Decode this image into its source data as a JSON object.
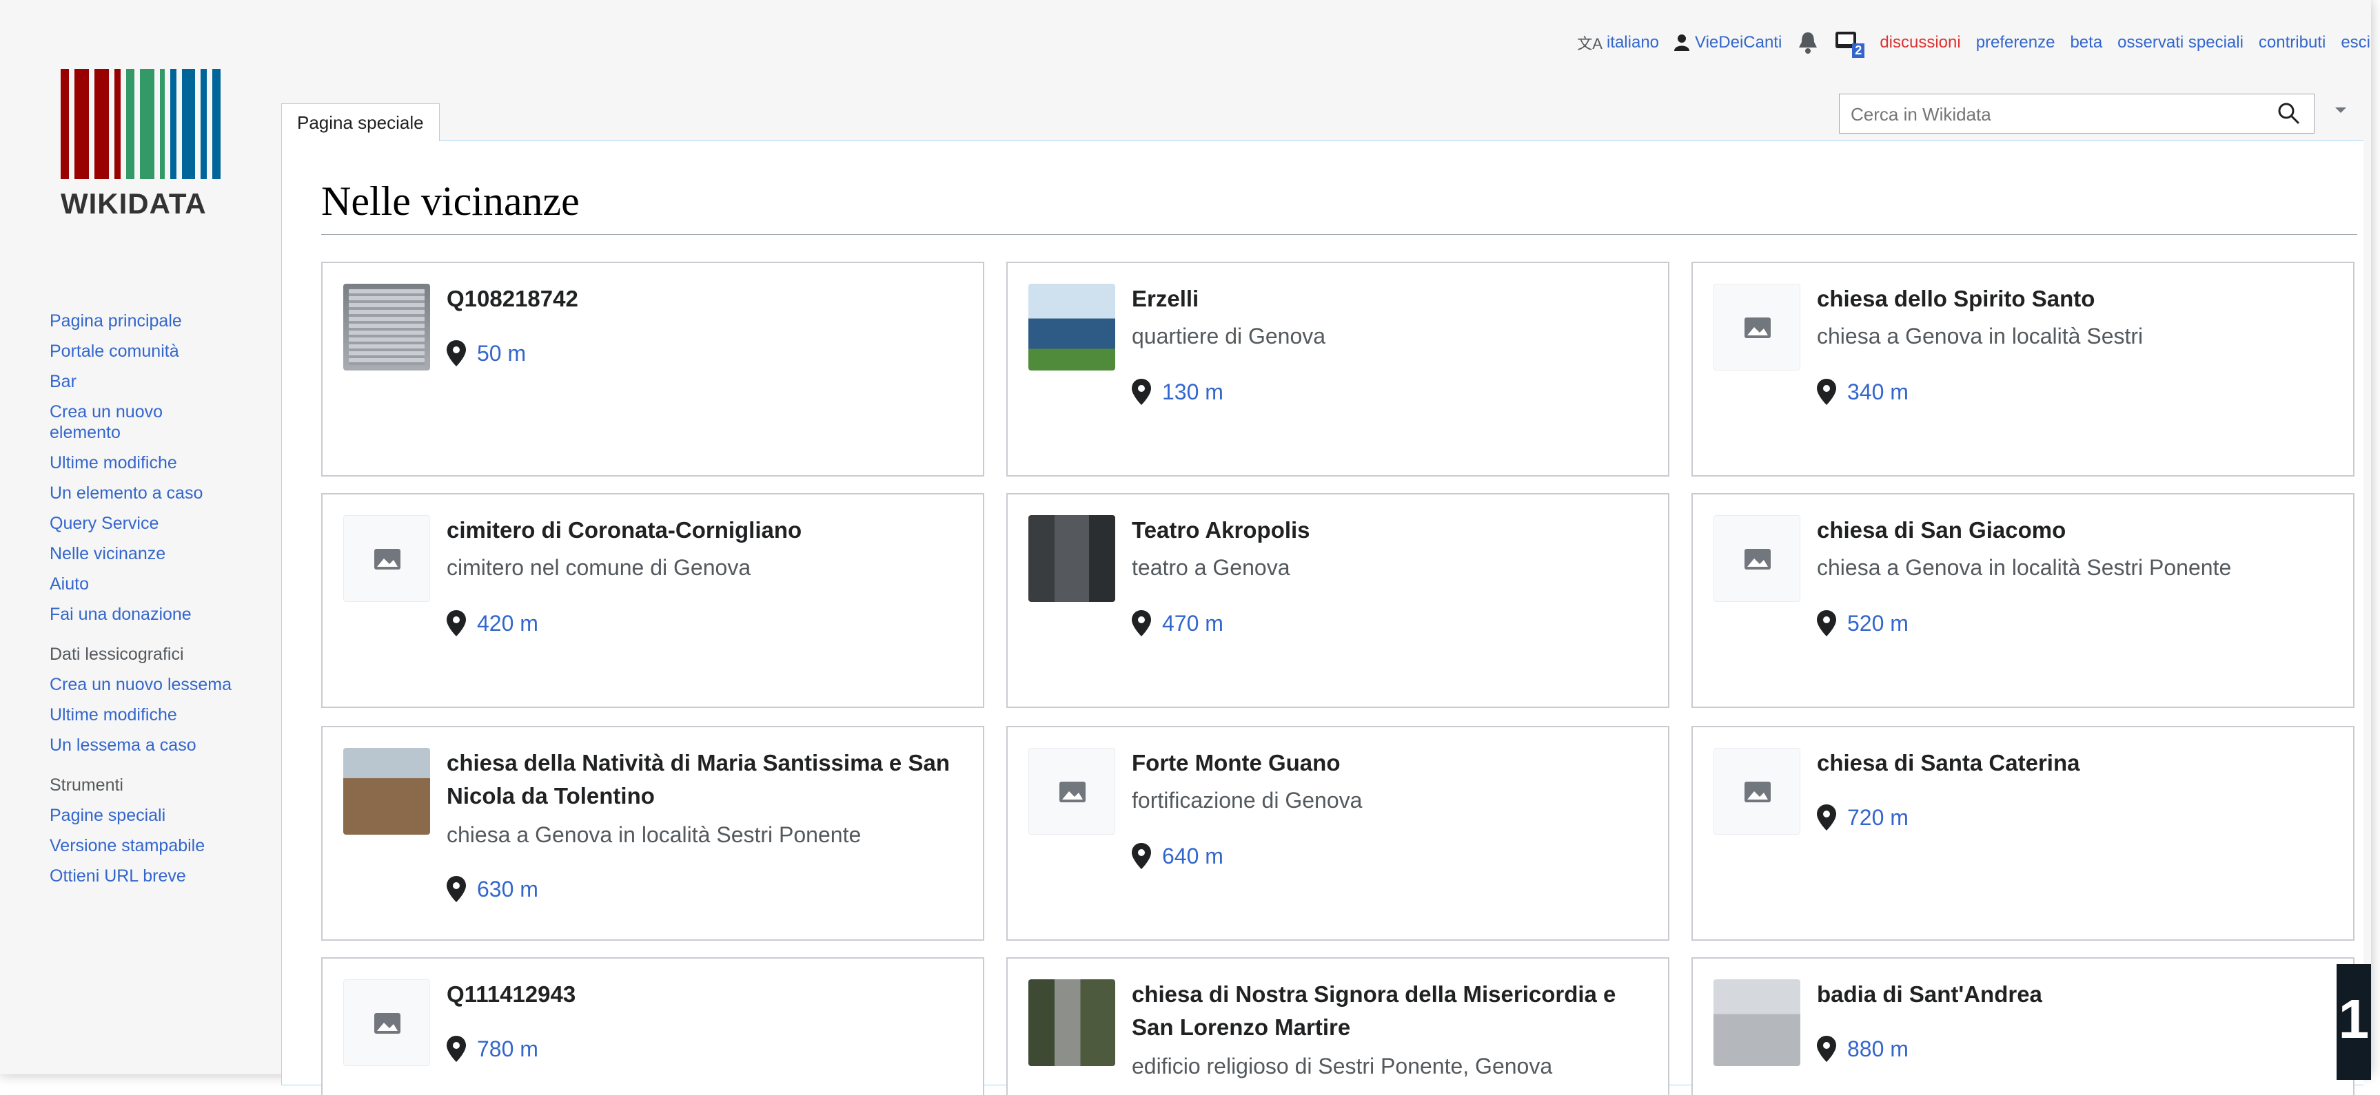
{
  "header": {
    "language": "italiano",
    "user": "VieDeiCanti",
    "notifications_count": "2",
    "links": [
      "discussioni",
      "preferenze",
      "beta",
      "osservati speciali",
      "contributi",
      "esci"
    ]
  },
  "logo": {
    "text": "WIKIDATA"
  },
  "tab": {
    "label": "Pagina speciale"
  },
  "search": {
    "placeholder": "Cerca in Wikidata"
  },
  "page": {
    "title": "Nelle vicinanze"
  },
  "sidebar": {
    "main": [
      "Pagina principale",
      "Portale comunità",
      "Bar",
      "Crea un nuovo elemento",
      "Ultime modifiche",
      "Un elemento a caso",
      "Query Service",
      "Nelle vicinanze",
      "Aiuto",
      "Fai una donazione"
    ],
    "lex_heading": "Dati lessicografici",
    "lex": [
      "Crea un nuovo lessema",
      "Ultime modifiche",
      "Un lessema a caso"
    ],
    "tools_heading": "Strumenti",
    "tools": [
      "Pagine speciali",
      "Versione stampabile",
      "Ottieni URL breve"
    ]
  },
  "cards": [
    {
      "title": "Q108218742",
      "desc": "",
      "distance": "50 m",
      "thumb": "plaque-photo"
    },
    {
      "title": "Erzelli",
      "desc": "quartiere di Genova",
      "distance": "130 m",
      "thumb": "building-photo"
    },
    {
      "title": "chiesa dello Spirito Santo",
      "desc": "chiesa a Genova in località Sestri",
      "distance": "340 m",
      "thumb": "placeholder"
    },
    {
      "title": "cimitero di Coronata-Cornigliano",
      "desc": "cimitero nel comune di Genova",
      "distance": "420 m",
      "thumb": "placeholder"
    },
    {
      "title": "Teatro Akropolis",
      "desc": "teatro a Genova",
      "distance": "470 m",
      "thumb": "theatre-photo"
    },
    {
      "title": "chiesa di San Giacomo",
      "desc": "chiesa a Genova in località Sestri Ponente",
      "distance": "520 m",
      "thumb": "placeholder"
    },
    {
      "title": "chiesa della Natività di Maria Santissima e San Nicola da Tolentino",
      "desc": "chiesa a Genova in località Sestri Ponente",
      "distance": "630 m",
      "thumb": "church-photo"
    },
    {
      "title": "Forte Monte Guano",
      "desc": "fortificazione di Genova",
      "distance": "640 m",
      "thumb": "placeholder"
    },
    {
      "title": "chiesa di Santa Caterina",
      "desc": "",
      "distance": "720 m",
      "thumb": "placeholder"
    },
    {
      "title": "Q111412943",
      "desc": "",
      "distance": "780 m",
      "thumb": "placeholder"
    },
    {
      "title": "chiesa di Nostra Signora della Misericordia e San Lorenzo Martire",
      "desc": "edificio religioso di Sestri Ponente, Genova",
      "distance": "",
      "thumb": "statue-photo"
    },
    {
      "title": "badia di Sant'Andrea",
      "desc": "",
      "distance": "880 m",
      "thumb": "abbey-photo"
    }
  ],
  "corner_badge": "1"
}
